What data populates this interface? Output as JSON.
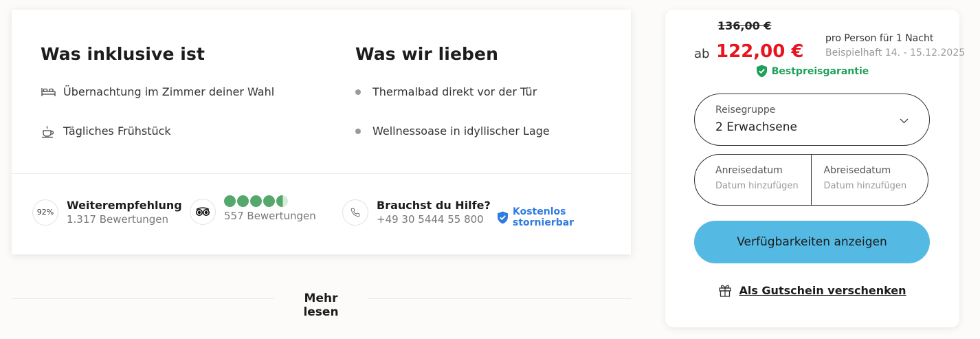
{
  "included": {
    "title": "Was inklusive ist",
    "items": [
      {
        "icon": "bed-icon",
        "label": "Übernachtung im Zimmer deiner Wahl"
      },
      {
        "icon": "coffee-cup-icon",
        "label": "Tägliches Frühstück"
      }
    ]
  },
  "love": {
    "title": "Was wir lieben",
    "items": [
      {
        "label": "Thermalbad direkt vor der Tür"
      },
      {
        "label": "Wellnessoase in idyllischer Lage"
      }
    ]
  },
  "stats": {
    "recommend": {
      "badge": "92%",
      "title": "Weiterempfehlung",
      "sub": "1.317 Bewertungen"
    },
    "tripadvisor": {
      "icon": "tripadvisor-owl-icon",
      "rating": 4.5,
      "max": 5,
      "sub": "557 Bewertungen",
      "color": "#54a86b"
    },
    "help": {
      "icon": "phone-icon",
      "title": "Brauchst du Hilfe?",
      "phone": "+49 30 5444 55 800"
    },
    "cancel": {
      "icon": "shield-check-icon",
      "label": "Kostenlos stornierbar",
      "color": "#2f7be0"
    }
  },
  "more": {
    "label": "Mehr lesen"
  },
  "booking": {
    "old_price": "136,00 €",
    "prefix": "ab",
    "price": "122,00 €",
    "price_color": "#e6151f",
    "note_line1": "pro Person für 1 Nacht",
    "note_line2": "Beispielhaft 14. - 15.12.2025",
    "best_price": "Bestpreisgarantie",
    "best_price_color": "#1ea05a",
    "travel_group": {
      "label": "Reisegruppe",
      "value": "2 Erwachsene"
    },
    "arrival": {
      "label": "Anreisedatum",
      "placeholder": "Datum hinzufügen"
    },
    "departure": {
      "label": "Abreisedatum",
      "placeholder": "Datum hinzufügen"
    },
    "cta": "Verfügbarkeiten anzeigen",
    "cta_color": "#54b9e3",
    "voucher": "Als Gutschein verschenken"
  }
}
